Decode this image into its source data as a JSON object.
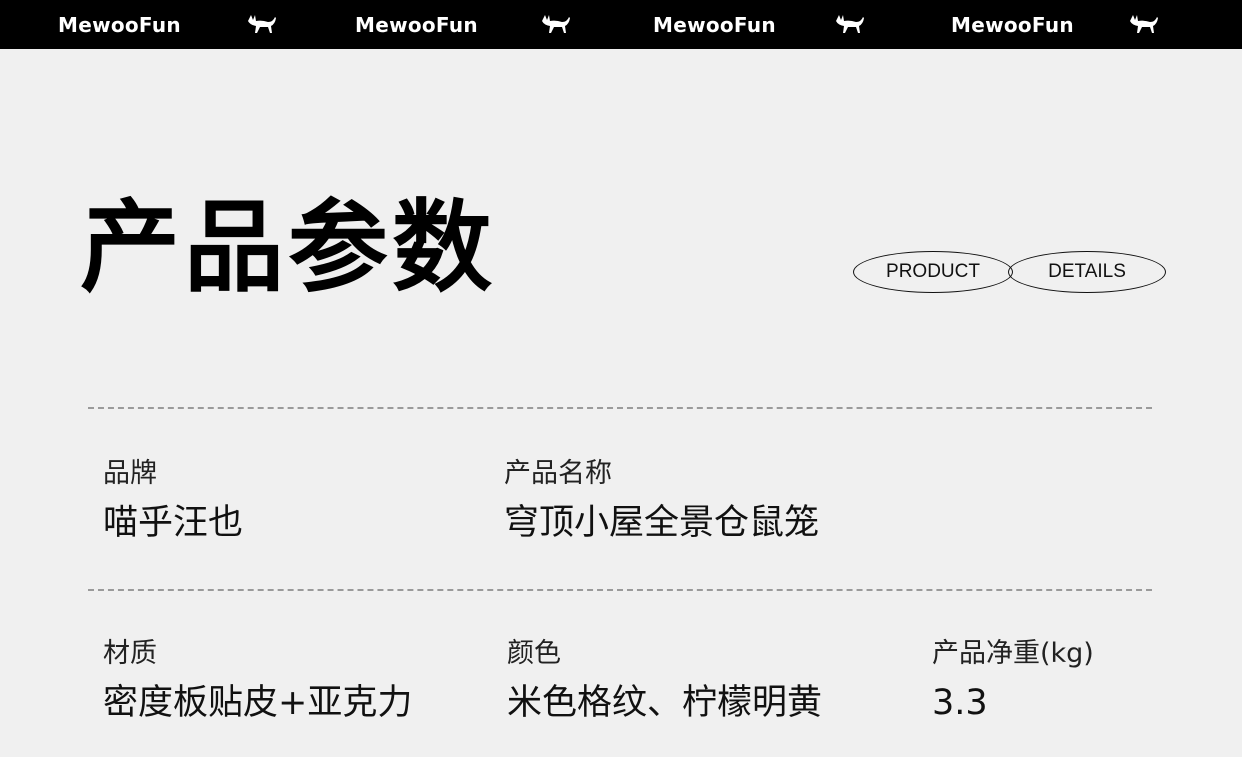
{
  "topbar": {
    "brand": "MewooFun",
    "icon": "cat-icon"
  },
  "page": {
    "title": "产品参数",
    "tags": [
      "PRODUCT",
      "DETAILS"
    ]
  },
  "specs": {
    "brand_label": "品牌",
    "brand_value": "喵乎汪也",
    "name_label": "产品名称",
    "name_value": "穹顶小屋全景仓鼠笼",
    "material_label": "材质",
    "material_value": "密度板贴皮+亚克力",
    "color_label": "颜色",
    "color_value": "米色格纹、柠檬明黄",
    "weight_label": "产品净重(kg)",
    "weight_value": "3.3"
  },
  "colors": {
    "topbar_bg": "#000000",
    "background": "#f0f0f0",
    "text": "#111111"
  }
}
